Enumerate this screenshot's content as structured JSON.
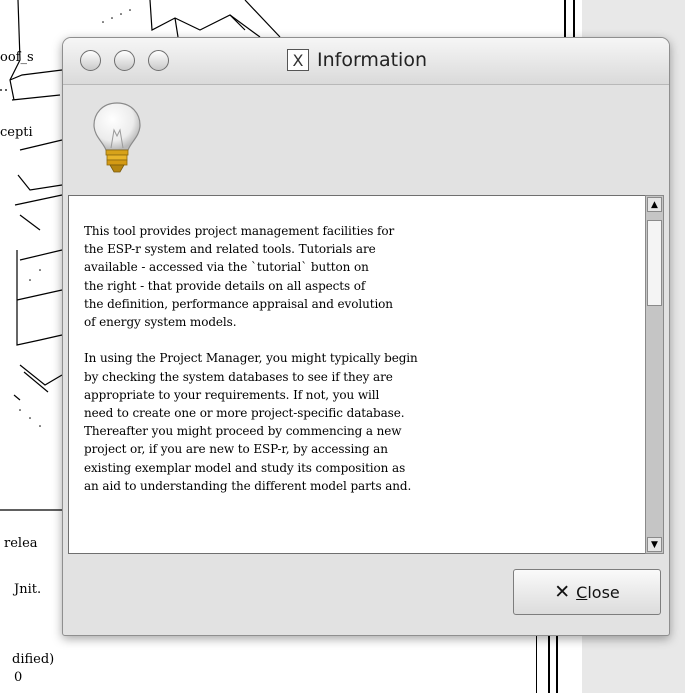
{
  "window": {
    "title": "Information",
    "title_icon": "x11-icon"
  },
  "background": {
    "fragments": [
      "oof_s",
      "cepti",
      "relea",
      "Jnit.",
      "dified)",
      "0"
    ]
  },
  "dialog": {
    "icon": "lightbulb-icon",
    "paragraph1": "This tool provides project management facilities for\nthe ESP-r system and related tools. Tutorials are\navailable - accessed via the `tutorial` button on\nthe right - that provide details on all aspects of\nthe definition, performance appraisal and evolution\nof energy system models.",
    "paragraph2": "In using the Project Manager, you might typically begin\nby checking the system databases to see if they are\nappropriate to your requirements. If not, you will\nneed to create one or more project-specific database.\nThereafter you might proceed by commencing a new\nproject or, if you are new to ESP-r, by accessing an\nexisting exemplar model and study its composition as\nan aid to understanding the different model parts and.",
    "close_button": {
      "mnemonic": "C",
      "rest": "lose",
      "icon": "close-x-icon"
    }
  }
}
